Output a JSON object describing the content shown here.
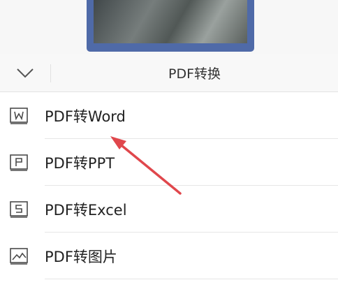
{
  "header": {
    "title": "PDF转换"
  },
  "menu": {
    "items": [
      {
        "label": "PDF转Word",
        "icon": "word-doc-icon"
      },
      {
        "label": "PDF转PPT",
        "icon": "ppt-doc-icon"
      },
      {
        "label": "PDF转Excel",
        "icon": "excel-doc-icon"
      },
      {
        "label": "PDF转图片",
        "icon": "image-doc-icon"
      }
    ]
  },
  "colors": {
    "annotation_arrow": "#e0474c",
    "icon_stroke": "#4a4a4a"
  }
}
